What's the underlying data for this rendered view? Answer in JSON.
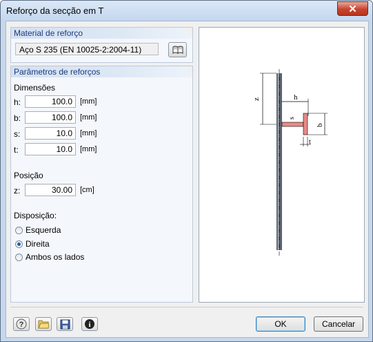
{
  "window": {
    "title": "Reforço da secção em T",
    "close_glyph": "✕"
  },
  "material": {
    "header": "Material de reforço",
    "value": "Aço S 235 (EN 10025-2:2004-11)",
    "library_icon": "book-icon"
  },
  "params": {
    "header": "Parâmetros de reforços",
    "dimensions_label": "Dimensões",
    "fields": [
      {
        "label": "h:",
        "value": "100.0",
        "unit": "[mm]"
      },
      {
        "label": "b:",
        "value": "100.0",
        "unit": "[mm]"
      },
      {
        "label": "s:",
        "value": "10.0",
        "unit": "[mm]"
      },
      {
        "label": "t:",
        "value": "10.0",
        "unit": "[mm]"
      }
    ],
    "position_label": "Posição",
    "z": {
      "label": "z:",
      "value": "30.00",
      "unit": "[cm]"
    },
    "disposition_label": "Disposição:",
    "options": [
      {
        "label": "Esquerda",
        "selected": false
      },
      {
        "label": "Direita",
        "selected": true
      },
      {
        "label": "Ambos os lados",
        "selected": false
      }
    ]
  },
  "diagram": {
    "labels": {
      "z": "z",
      "h": "h",
      "s": "s",
      "b": "b",
      "t": "t"
    },
    "web_color": "#5a6270",
    "stiffener_color": "#e88a88"
  },
  "footer": {
    "icons": [
      "help-icon",
      "open-folder-icon",
      "save-icon",
      "info-icon"
    ],
    "ok_label": "OK",
    "cancel_label": "Cancelar"
  }
}
